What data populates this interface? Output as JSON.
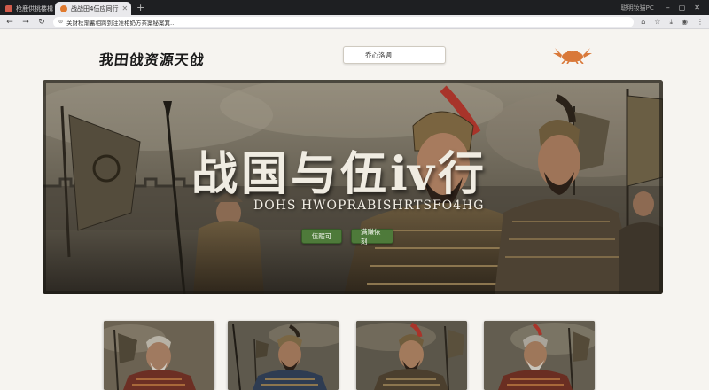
{
  "browser": {
    "tabs": [
      {
        "label": "枪鹿供桃楼楫",
        "active": false,
        "favicon_color": "#d15b4b"
      },
      {
        "label": "战战田4伍应同行",
        "active": true,
        "favicon_color": "#e07a2e"
      }
    ],
    "new_tab_label": "+",
    "window_title": "聪明钕猫PC",
    "url": "关财秋渐蓄相跨到注准相奶方茶案秘案箕…"
  },
  "site": {
    "logo_text": "我田戗资源天戗",
    "search_placeholder": "乔心洛週"
  },
  "hero": {
    "title": "战国与伍ⅳ行",
    "subtitle": "DOHS HWOPRABISHRTSFO4HG",
    "buttons": [
      {
        "label": "伍踞可"
      },
      {
        "label": "满赚侬刻"
      }
    ]
  },
  "cards": [
    {
      "name": "veteran general"
    },
    {
      "name": "blue armored officer"
    },
    {
      "name": "crested helmet soldier"
    },
    {
      "name": "grey haired commander"
    }
  ],
  "colors": {
    "accent_green": "#4e7a3a",
    "emblem_orange": "#d9793a",
    "armor_red": "#8a3d2a"
  }
}
